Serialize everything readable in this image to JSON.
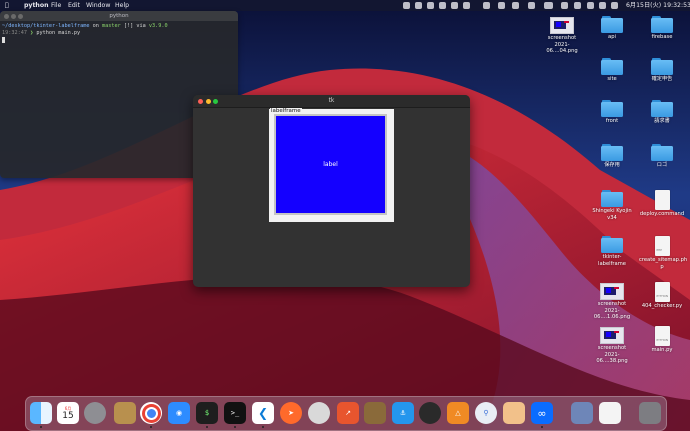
{
  "colors": {
    "accent_blue": "#1400ff",
    "folder_blue": "#3a9ae2",
    "tk_bg": "#323232"
  },
  "menubar": {
    "app": "python",
    "menus": [
      "File",
      "Edit",
      "Window",
      "Help"
    ],
    "clock": "6月15日(火) 19:32:53",
    "status_icons": [
      "python-rocket-icon",
      "apple-logo-icon",
      "b-icon",
      "record-icon",
      "pan-icon",
      "dropbox-icon",
      "git-icon",
      "cloud-icon",
      "control-icon",
      "bluetooth-icon",
      "battery-icon",
      "wifi-icon",
      "search-icon",
      "user-icon",
      "control-center-icon",
      "siri-icon"
    ]
  },
  "terminal": {
    "title": "python",
    "line1": {
      "path": "~/desktop/tkinter-labelframe",
      "on": "on",
      "branch": "master",
      "info": "[!] via",
      "py": "v3.9.0"
    },
    "line2": {
      "time": "19:32:47",
      "cmd": "python main.py"
    }
  },
  "tk_window": {
    "title": "tk",
    "labelframe_text": "labelframe",
    "label_text": "label"
  },
  "desktop_icons": [
    {
      "label": "screenshot\n2021-06....04.png",
      "kind": "screenshot"
    },
    {
      "label": "api",
      "kind": "folder"
    },
    {
      "label": "firebase",
      "kind": "folder"
    },
    {
      "label": "site",
      "kind": "folder"
    },
    {
      "label": "確定申告",
      "kind": "folder"
    },
    {
      "label": "front",
      "kind": "folder"
    },
    {
      "label": "請求書",
      "kind": "folder"
    },
    {
      "label": "保存用",
      "kind": "folder"
    },
    {
      "label": "ロゴ",
      "kind": "folder"
    },
    {
      "label": "Shingeki Kyojin\nv34",
      "kind": "folder"
    },
    {
      "label": "deploy.command",
      "kind": "doc",
      "tag": ""
    },
    {
      "label": "tkinter-labelframe",
      "kind": "folder"
    },
    {
      "label": "create_sitemap.ph\np",
      "kind": "doc",
      "tag": "PHP"
    },
    {
      "label": "screenshot\n2021-06....1.06.png",
      "kind": "screenshot"
    },
    {
      "label": "404_checker.py",
      "kind": "doc",
      "tag": "PYTHON"
    },
    {
      "label": "screenshot\n2021-06....38.png",
      "kind": "screenshot"
    },
    {
      "label": "main.py",
      "kind": "doc",
      "tag": "PYTHON"
    }
  ],
  "dock": {
    "apps": [
      "finder-icon",
      "calendar-icon",
      "system-preferences-icon",
      "cardhop-icon",
      "chrome-icon",
      "zoom-icon",
      "terminal-icon",
      "terminal-dark-icon",
      "vscode-icon",
      "safari-icon",
      "sequel-icon",
      "activity-icon",
      "archive-icon",
      "docker-icon",
      "quicktime-icon",
      "sourcetree-icon",
      "browser-icon",
      "preview-icon",
      "infinity-icon",
      "downloads-icon",
      "document-icon",
      "trash-icon"
    ],
    "calendar_month": "6月",
    "calendar_day": "15"
  }
}
